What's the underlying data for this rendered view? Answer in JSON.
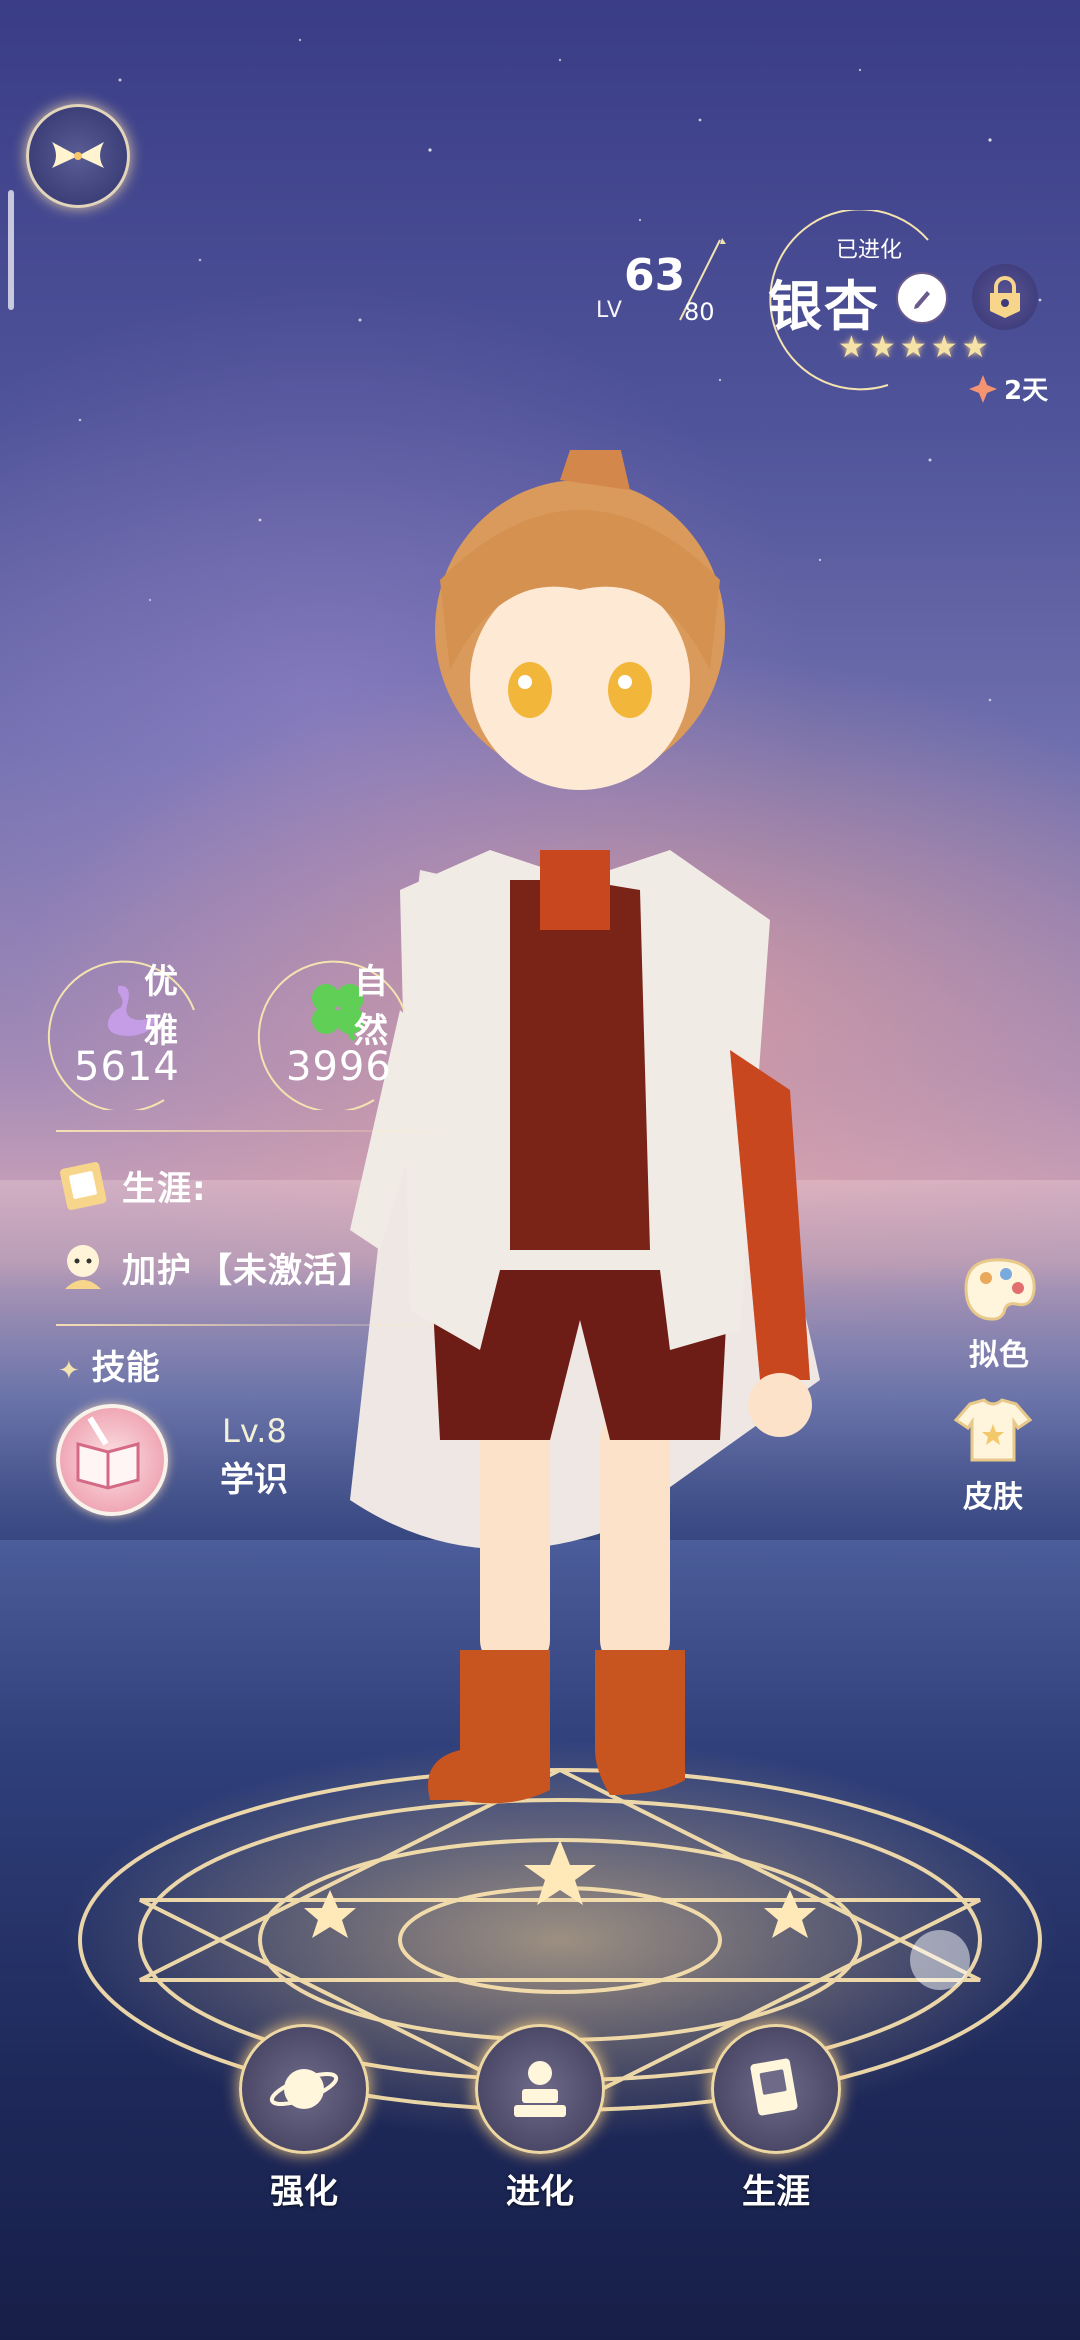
{
  "header": {
    "level": "63",
    "level_label": "LV",
    "level_max": "80",
    "status_tag": "已进化",
    "character_name": "银杏",
    "star_count": 5,
    "timer": "2天"
  },
  "stats": [
    {
      "label": "优雅",
      "value": "5614",
      "icon": "swan-icon",
      "color": "#c59ce6"
    },
    {
      "label": "自然",
      "value": "3996",
      "icon": "clover-icon",
      "color": "#5fcf55"
    }
  ],
  "info": {
    "career_label": "生涯:",
    "blessing_label": "加护",
    "blessing_status": "【未激活】"
  },
  "skill": {
    "title": "技能",
    "level": "Lv.8",
    "name": "学识"
  },
  "side_buttons": {
    "dye_label": "拟色",
    "skin_label": "皮肤"
  },
  "bottom_nav": {
    "enhance_label": "强化",
    "evolve_label": "进化",
    "career_label": "生涯"
  },
  "colors": {
    "accent_gold": "#f3e3b0",
    "timer_diamond": "#f59470"
  }
}
